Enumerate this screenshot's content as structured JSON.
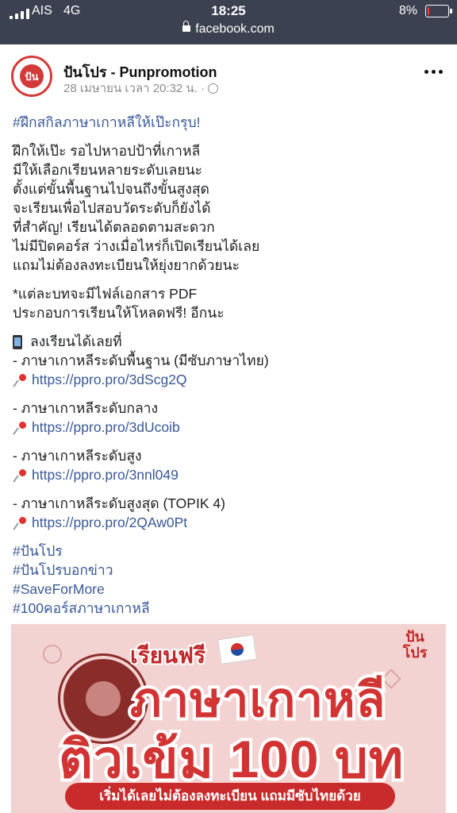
{
  "status_bar": {
    "carrier": "AIS",
    "network": "4G",
    "time": "18:25",
    "battery_text": "8%",
    "battery_level": 0.08,
    "battery_color": "#ff3b30",
    "url": "facebook.com",
    "icons": [
      "signal-icon",
      "lock-icon",
      "battery-icon"
    ]
  },
  "post": {
    "page_name": "ปันโปร - Punpromotion",
    "timestamp": "28 เมษายน เวลา 20:32 น. ·",
    "avatar_text": "ปัน",
    "headline_hashtag": "#ฝึกสกิลภาษาเกาหลีให้เป๊ะกรุบ!",
    "intro_lines": [
      "ฝึกให้เป๊ะ รอไปหาอปป้าที่เกาหลี",
      "มีให้เลือกเรียนหลายระดับเลยนะ",
      "ตั้งแต่ขั้นพื้นฐานไปจนถึงขั้นสูงสุด",
      "จะเรียนเพื่อไปสอบวัดระดับก็ยังได้",
      "ที่สำคัญ! เรียนได้ตลอดตามสะดวก",
      "ไม่มีปิดคอร์ส ว่างเมื่อไหร่ก็เปิดเรียนได้เลย",
      "แถมไม่ต้องลงทะเบียนให้ยุ่งยากด้วยนะ"
    ],
    "pdf_lines": [
      "*แต่ละบทจะมีไฟล์เอกสาร PDF",
      "ประกอบการเรียนให้โหลดฟรี! อีกนะ"
    ],
    "register_label": "ลงเรียนได้เลยที่",
    "courses": [
      {
        "name": "- ภาษาเกาหลีระดับพื้นฐาน (มีซับภาษาไทย)",
        "url": "https://ppro.pro/3dScg2Q"
      },
      {
        "name": "- ภาษาเกาหลีระดับกลาง",
        "url": "https://ppro.pro/3dUcoib"
      },
      {
        "name": "- ภาษาเกาหลีระดับสูง",
        "url": "https://ppro.pro/3nnl049"
      },
      {
        "name": "- ภาษาเกาหลีระดับสูงสุด (TOPIK 4)",
        "url": "https://ppro.pro/2QAw0Pt"
      }
    ],
    "hashtags": [
      "#ปันโปร",
      "#ปันโปรบอกข่าว",
      "#SaveForMore",
      "#100คอร์สภาษาเกาหลี"
    ],
    "link_color": "#385898"
  },
  "banner": {
    "free_label": "เรียนฟรี",
    "title_line1": "ภาษาเกาหลี",
    "title_line2": "ติวเข้ม 100 บท",
    "subtitle": "เริ่มได้เลยไม่ต้องลงทะเบียน แถมมีซับไทยด้วย",
    "logo_line1": "ปัน",
    "logo_line2": "โปร",
    "seal_text": "THE CYBER UNIVERSITY OF KOREA",
    "accent_color": "#d23433",
    "background_color": "#f3d3d2"
  }
}
